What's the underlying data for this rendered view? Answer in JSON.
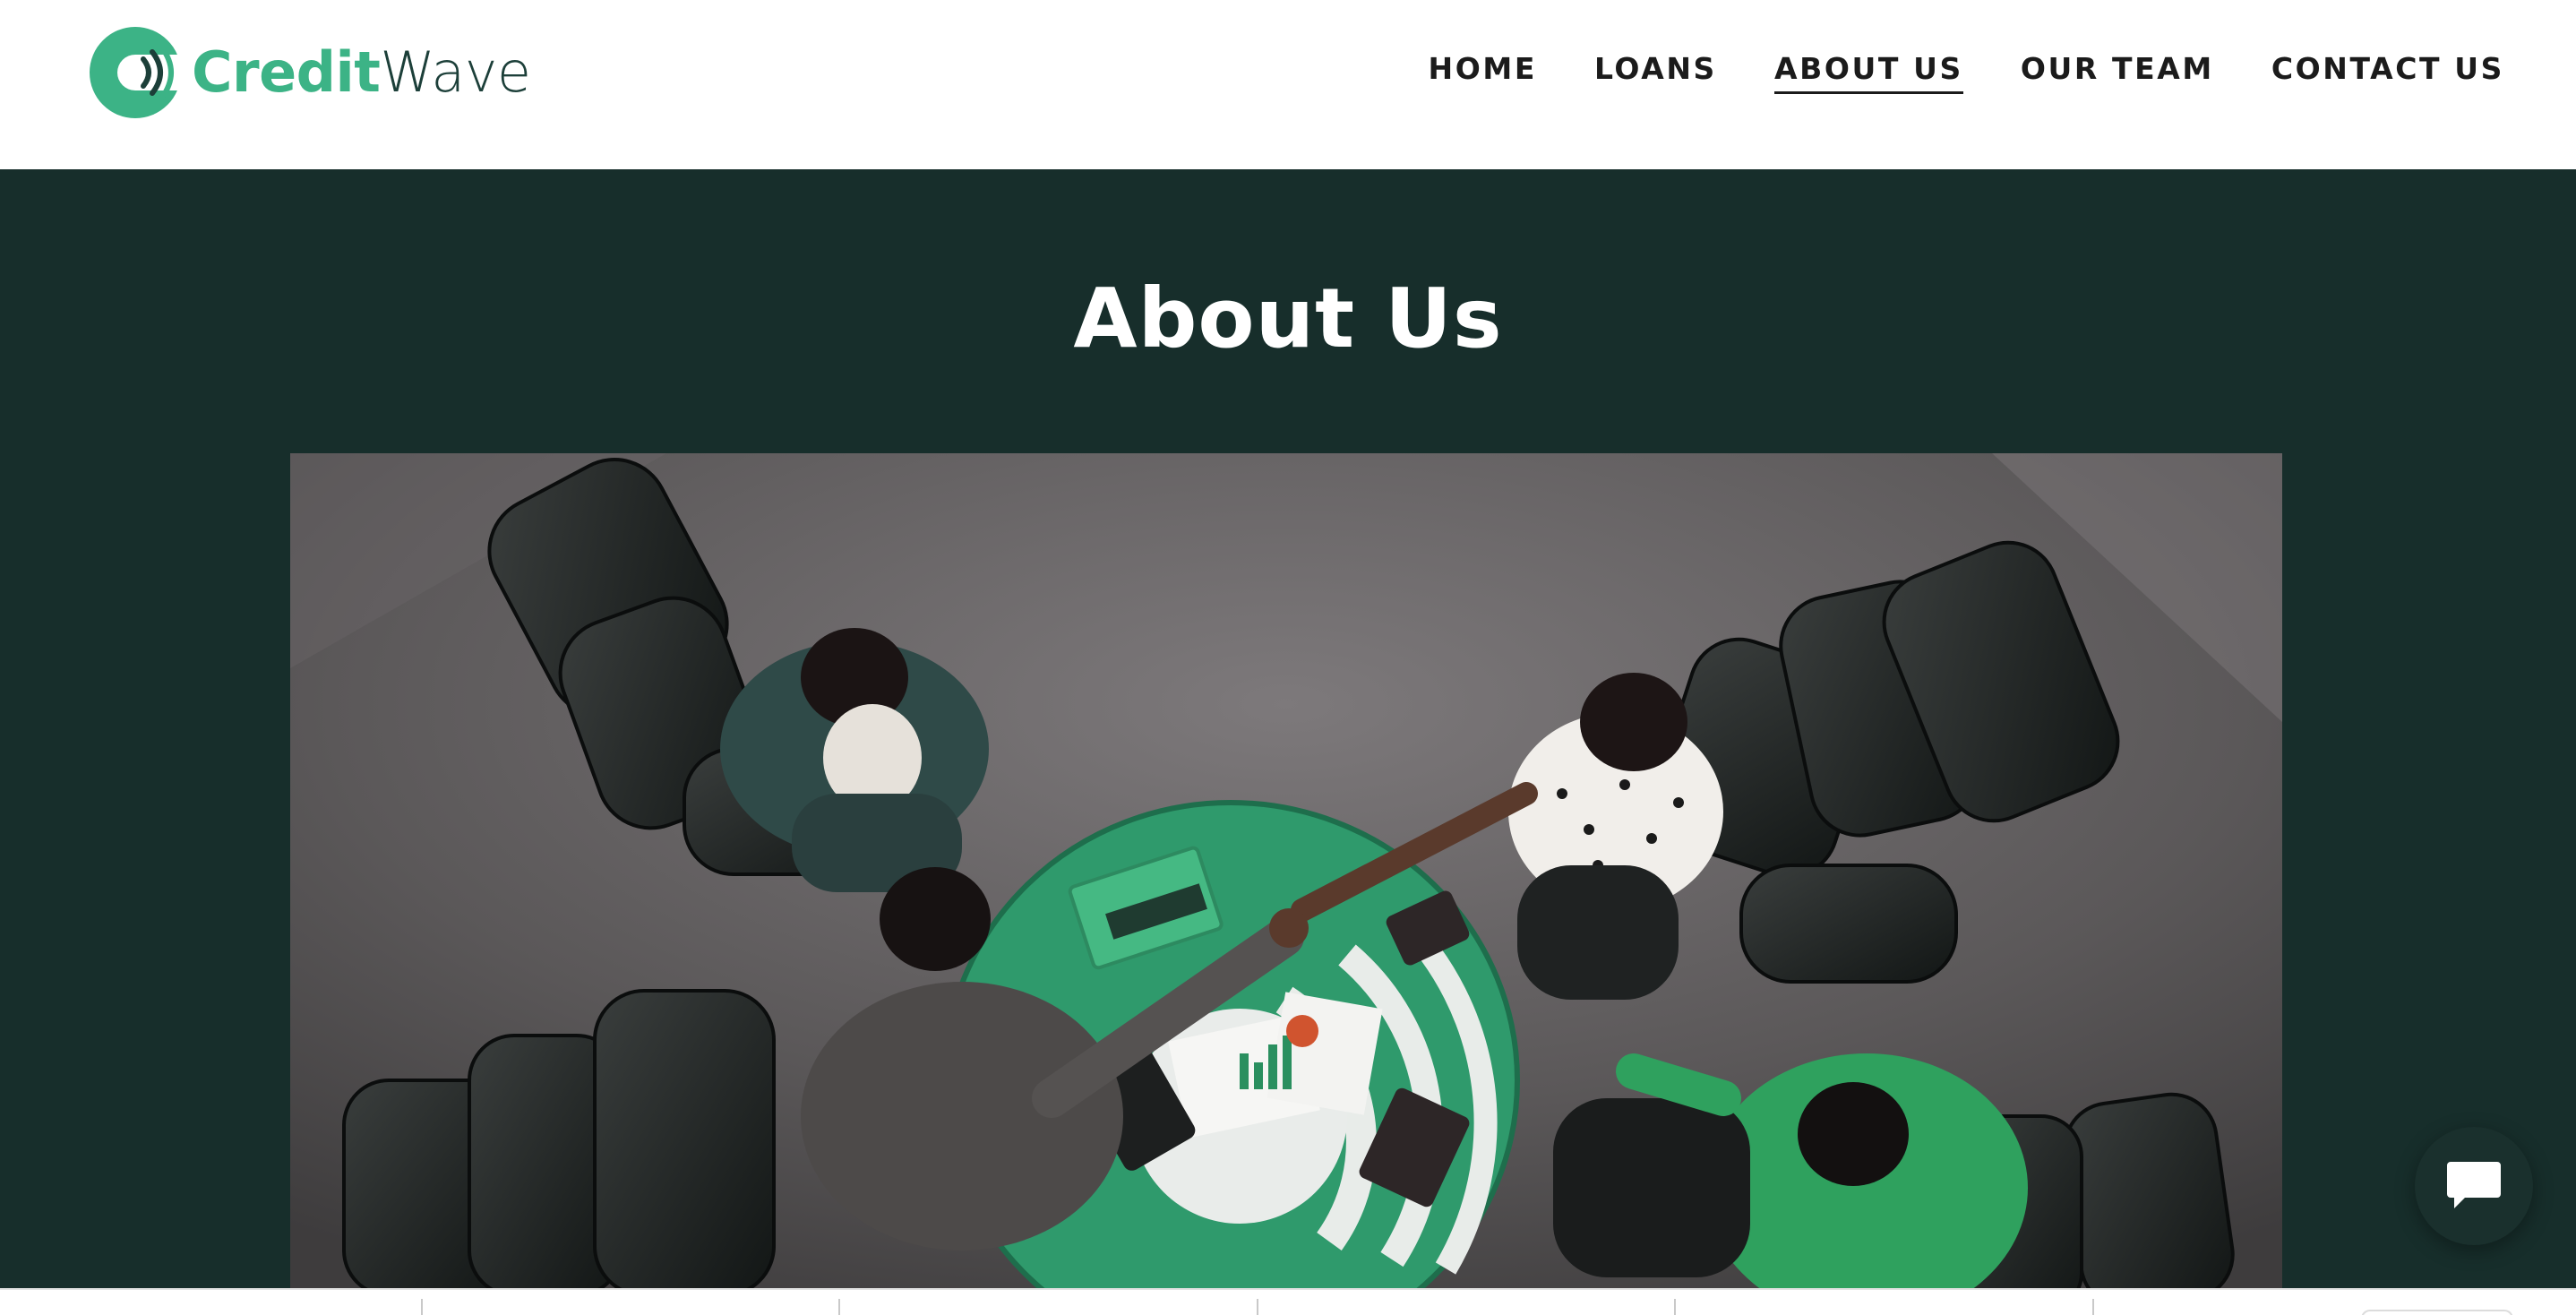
{
  "brand": {
    "name_part1": "Credit",
    "name_part2": "Wave",
    "logo_icon": "creditwave-logo-icon",
    "colors": {
      "green": "#3cb386",
      "dark": "#1c3f39"
    }
  },
  "nav": {
    "items": [
      {
        "label": "HOME",
        "active": false
      },
      {
        "label": "LOANS",
        "active": false
      },
      {
        "label": "ABOUT US",
        "active": true
      },
      {
        "label": "OUR TEAM",
        "active": false
      },
      {
        "label": "CONTACT US",
        "active": false
      }
    ]
  },
  "hero": {
    "title": "About Us",
    "background_color": "#172e2b",
    "image_subject": "four-people-around-green-table-handshake-photo"
  },
  "chat": {
    "icon": "chat-bubble-icon"
  }
}
